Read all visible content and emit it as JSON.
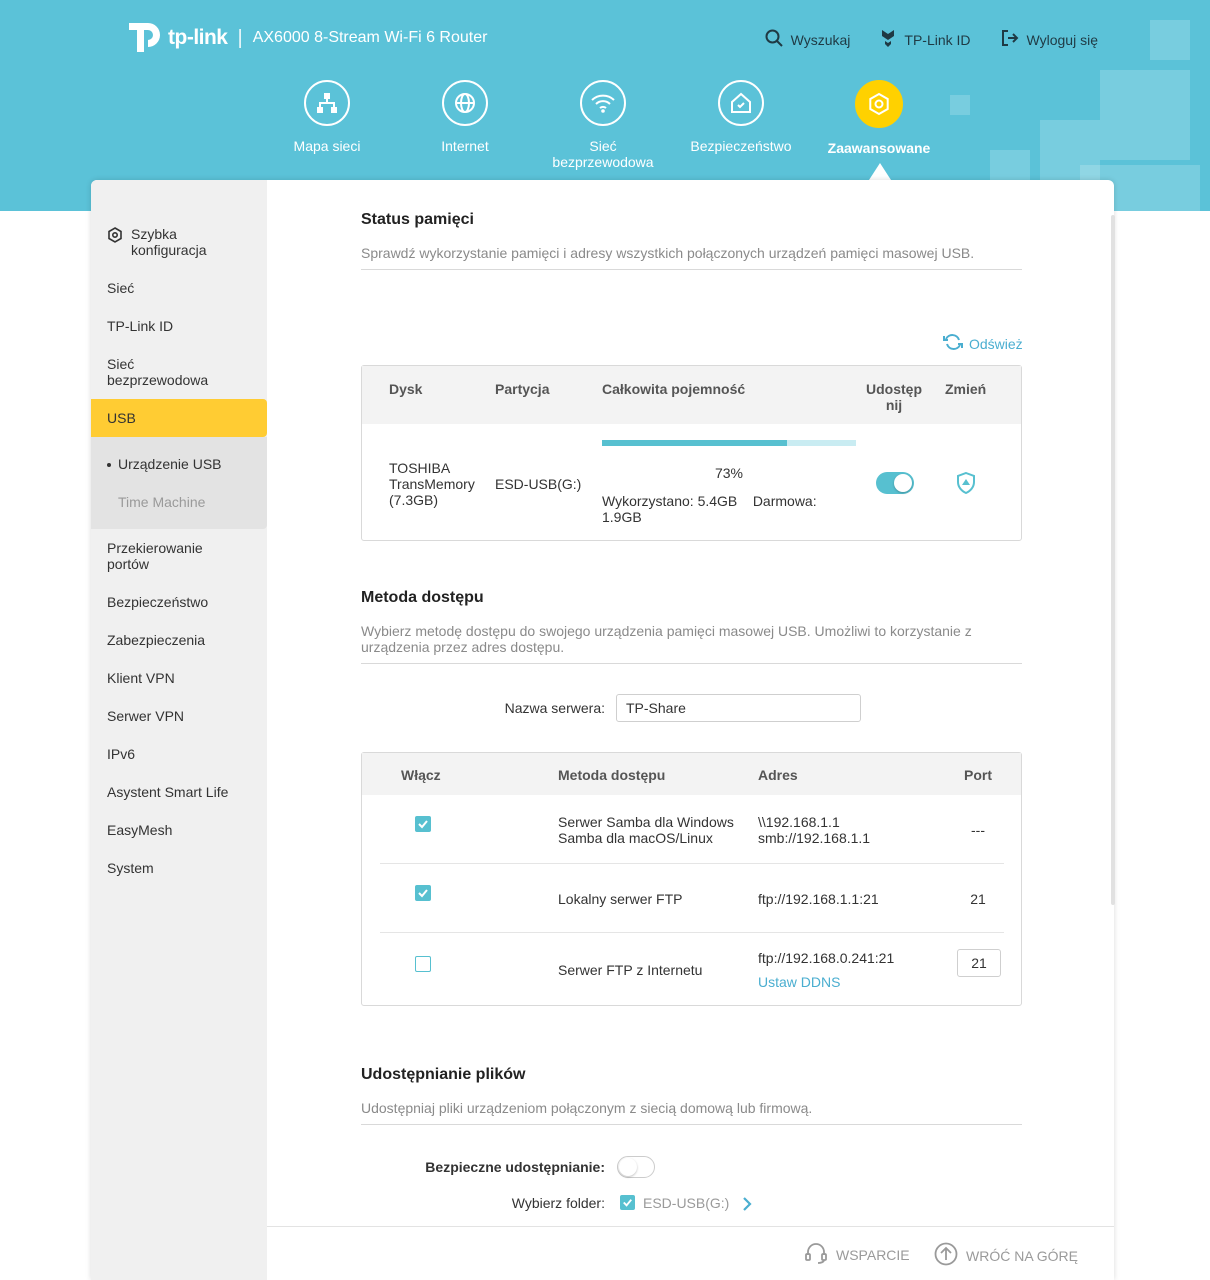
{
  "header": {
    "brand": "tp-link",
    "model": "AX6000 8-Stream Wi-Fi 6 Router",
    "links": {
      "search": "Wyszukaj",
      "tplink_id": "TP-Link ID",
      "logout": "Wyloguj się"
    },
    "nav": [
      {
        "label": "Mapa sieci"
      },
      {
        "label": "Internet"
      },
      {
        "label": "Sieć bezprzewodowa"
      },
      {
        "label": "Bezpieczeństwo"
      },
      {
        "label": "Zaawansowane",
        "active": true
      }
    ]
  },
  "sidebar": {
    "items": [
      {
        "label": "Szybka konfiguracja"
      },
      {
        "label": "Sieć"
      },
      {
        "label": "TP-Link ID"
      },
      {
        "label": "Sieć bezprzewodowa"
      },
      {
        "label": "USB",
        "active": true
      },
      {
        "label": "Przekierowanie portów"
      },
      {
        "label": "Bezpieczeństwo"
      },
      {
        "label": "Zabezpieczenia"
      },
      {
        "label": "Klient VPN"
      },
      {
        "label": "Serwer VPN"
      },
      {
        "label": "IPv6"
      },
      {
        "label": "Asystent Smart Life"
      },
      {
        "label": "EasyMesh"
      },
      {
        "label": "System"
      }
    ],
    "sub_items": [
      {
        "label": "Urządzenie USB",
        "active": true
      },
      {
        "label": "Time Machine"
      }
    ]
  },
  "storage": {
    "title": "Status pamięci",
    "description": "Sprawdź wykorzystanie pamięci i adresy wszystkich połączonych urządzeń pamięci masowej USB.",
    "refresh": "Odśwież",
    "columns": {
      "disk": "Dysk",
      "partition": "Partycja",
      "capacity": "Całkowita pojemność",
      "share": "Udostęp nij",
      "modify": "Zmień"
    },
    "rows": [
      {
        "disk": "TOSHIBA TransMemory (7.3GB)",
        "partition": "ESD-USB(G:)",
        "percent": "73%",
        "used_fraction": 0.73,
        "usage": "Wykorzystano: 5.4GB    Darmowa: 1.9GB",
        "shared": true
      }
    ]
  },
  "access": {
    "title": "Metoda dostępu",
    "description": "Wybierz metodę dostępu do swojego urządzenia pamięci masowej USB. Umożliwi to korzystanie z urządzenia przez adres dostępu.",
    "server_label": "Nazwa serwera:",
    "server_name": "TP-Share",
    "columns": {
      "enable": "Włącz",
      "method": "Metoda dostępu",
      "address": "Adres",
      "port": "Port"
    },
    "rows": [
      {
        "enabled": true,
        "method": "Serwer Samba dla Windows\nSamba dla macOS/Linux",
        "address": "\\\\192.168.1.1\nsmb://192.168.1.1",
        "port": "---"
      },
      {
        "enabled": true,
        "method": "Lokalny serwer FTP",
        "address": "ftp://192.168.1.1:21",
        "port": "21"
      },
      {
        "enabled": false,
        "method": "Serwer FTP z Internetu",
        "address": "ftp://192.168.0.241:21",
        "port": "21",
        "link": "Ustaw DDNS"
      }
    ]
  },
  "sharing": {
    "title": "Udostępnianie plików",
    "description": "Udostępniaj pliki urządzeniom połączonym z siecią domową lub firmową.",
    "secure_label": "Bezpieczne udostępnianie:",
    "secure_on": false,
    "folder_label": "Wybierz folder:",
    "folder_value": "ESD-USB(G:)"
  },
  "footer": {
    "support": "WSPARCIE",
    "back_to_top": "WRÓĆ NA GÓRĘ"
  },
  "colors": {
    "header": "#5bc2d8",
    "accent": "#57c0d0",
    "active": "#ffcc33"
  }
}
